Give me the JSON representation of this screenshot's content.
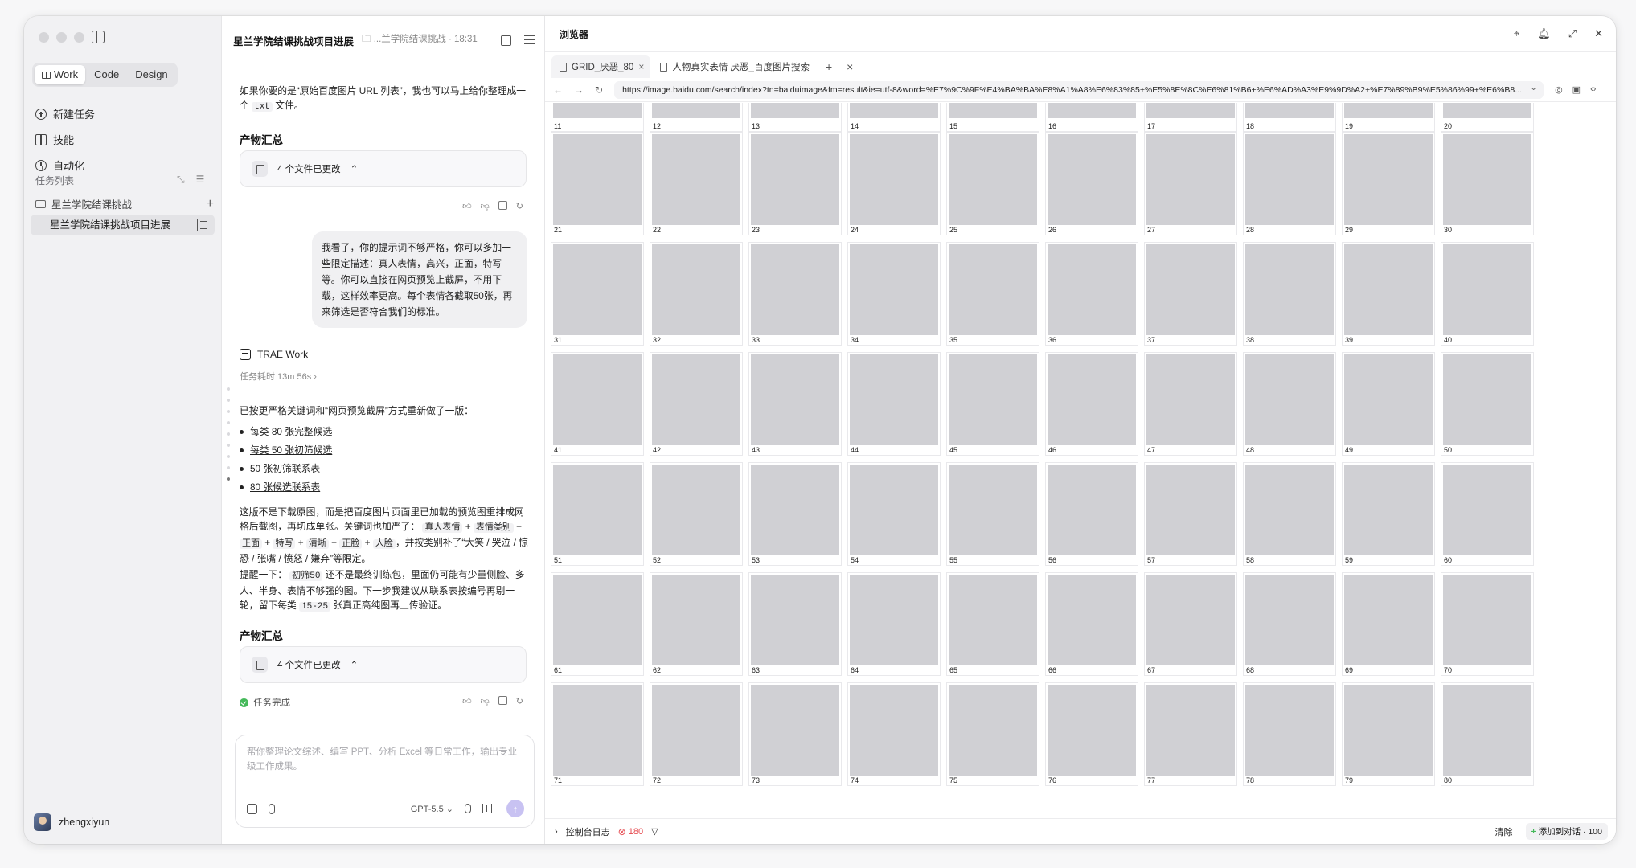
{
  "sidebar": {
    "modes": [
      "Work",
      "Code",
      "Design"
    ],
    "nav": [
      "新建任务",
      "技能",
      "自动化"
    ],
    "task_list_title": "任务列表",
    "folder": "星兰学院结课挑战",
    "task": "星兰学院结课挑战项目进展",
    "user": "zhengxiyun"
  },
  "chat": {
    "title": "星兰学院结课挑战项目进展",
    "crumb": "...兰学院结课挑战 · 18:31",
    "msg1_pre": "如果你要的是“原始百度图片 URL 列表”，我也可以马上给你整理成一个",
    "msg1_code": "txt",
    "msg1_post": "文件。",
    "summary_title": "产物汇总",
    "files_changed": "4 个文件已更改",
    "user_bubble": "我看了，你的提示词不够严格，你可以多加一些限定描述：真人表情，高兴，正面，特写等。你可以直接在网页预览上截屏，不用下载，这样效率更高。每个表情各截取50张，再来筛选是否符合我们的标准。",
    "agent_name": "TRAE Work",
    "elapsed": "任务耗时 13m 56s",
    "redo_intro": "已按更严格关键词和“网页预览截屏”方式重新做了一版：",
    "links": [
      "每类 80 张完整候选",
      "每类 50 张初筛候选",
      "50 张初筛联系表",
      "80 张候选联系表"
    ],
    "p1_a": "这版不是下载原图，而是把百度图片页面里已加载的预览图重排成网格后截图，再切成单张。关键词也加严了：",
    "p1_codes": [
      "真人表情",
      "表情类别",
      "正面",
      "特写",
      "清晰",
      "正脸",
      "人脸"
    ],
    "p1_b": "，并按类别补了“大笑 / 哭泣 / 惊恐 / 张嘴 / 愤怒 / 嫌弃”等限定。",
    "p2_a": "提醒一下：",
    "p2_code1": "初筛50",
    "p2_b": "还不是最终训练包，里面仍可能有少量侧脸、多人、半身、表情不够强的图。下一步我建议从联系表按编号再剔一轮，留下每类",
    "p2_code2": "15-25",
    "p2_c": "张真正高纯图再上传验证。",
    "status": "任务完成",
    "input_placeholder": "帮你整理论文综述、编写 PPT、分析 Excel 等日常工作，输出专业级工作成果。",
    "model": "GPT-5.5"
  },
  "browser": {
    "title": "浏览器",
    "tabs": [
      "GRID_厌恶_80",
      "人物真实表情 厌恶_百度图片搜索"
    ],
    "url": "https://image.baidu.com/search/index?tn=baiduimage&fm=result&ie=utf-8&word=%E7%9C%9F%E4%BA%BA%E8%A1%A8%E6%83%85+%E5%8E%8C%E6%81%B6+%E6%AD%A3%E9%9D%A2+%E7%89%B9%E5%86%99+%E6%B8...",
    "grid_numbers": [
      11,
      12,
      13,
      14,
      15,
      16,
      17,
      18,
      19,
      20,
      21,
      22,
      23,
      24,
      25,
      26,
      27,
      28,
      29,
      30,
      31,
      32,
      33,
      34,
      35,
      36,
      37,
      38,
      39,
      40,
      41,
      42,
      43,
      44,
      45,
      46,
      47,
      48,
      49,
      50,
      51,
      52,
      53,
      54,
      55,
      56,
      57,
      58,
      59,
      60,
      61,
      62,
      63,
      64,
      65,
      66,
      67,
      68,
      69,
      70,
      71,
      72,
      73,
      74,
      75,
      76,
      77,
      78,
      79,
      80
    ],
    "console_label": "控制台日志",
    "error_count": "180",
    "clear": "清除",
    "add_to_chat": "添加到对话 · 100"
  }
}
